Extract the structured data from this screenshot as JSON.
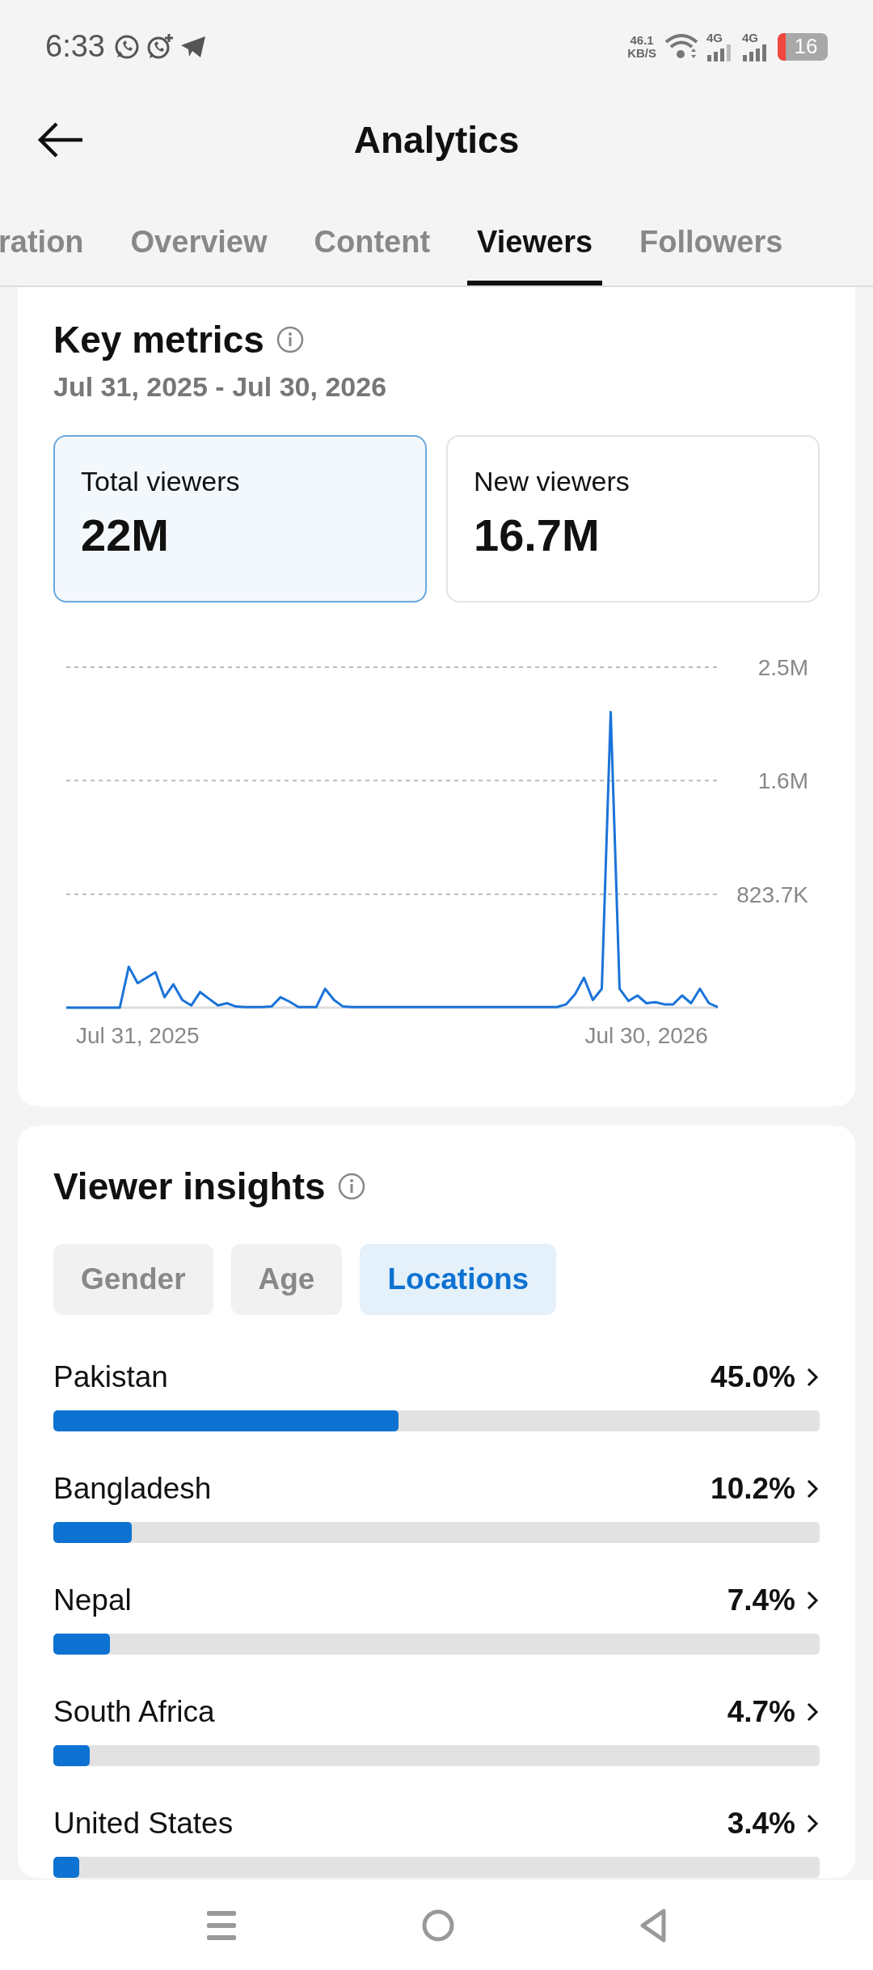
{
  "status_bar": {
    "time": "6:33",
    "net_speed": "46.1",
    "net_unit": "KB/S",
    "networks": [
      "4G",
      "4G"
    ],
    "battery": "16"
  },
  "header": {
    "title": "Analytics"
  },
  "tabs": [
    {
      "label": "ration",
      "selected": false
    },
    {
      "label": "Overview",
      "selected": false
    },
    {
      "label": "Content",
      "selected": false
    },
    {
      "label": "Viewers",
      "selected": true
    },
    {
      "label": "Followers",
      "selected": false
    }
  ],
  "key_metrics": {
    "title": "Key metrics",
    "date_range": "Jul 31, 2025 - Jul 30, 2026",
    "metrics": [
      {
        "label": "Total viewers",
        "value": "22M",
        "selected": true
      },
      {
        "label": "New viewers",
        "value": "16.7M",
        "selected": false
      }
    ],
    "chart_data": {
      "type": "line",
      "categories": [
        null,
        null,
        null,
        null,
        null,
        null,
        null,
        null,
        "Jul 31, 2025",
        null,
        null,
        null,
        null,
        null,
        null,
        null,
        null,
        null,
        null,
        null,
        null,
        null,
        null,
        null,
        null,
        null,
        null,
        null,
        null,
        null,
        null,
        null,
        null,
        null,
        null,
        null,
        null,
        null,
        null,
        null,
        null,
        null,
        null,
        null,
        null,
        null,
        null,
        null,
        null,
        null,
        null,
        null,
        null,
        null,
        null,
        null,
        null,
        null,
        null,
        null,
        null,
        null,
        null,
        null,
        null,
        "Jul 30, 2026",
        null,
        null,
        null,
        null,
        null,
        null,
        null,
        null
      ],
      "series": [
        {
          "color": "#1a73d9",
          "values": [
            0,
            0,
            0,
            0,
            0,
            0,
            0,
            297000,
            177000,
            217000,
            257000,
            76000,
            169000,
            56000,
            16000,
            113000,
            64000,
            16000,
            32000,
            8000,
            4000,
            4000,
            4000,
            8000,
            76000,
            44000,
            4000,
            4000,
            4000,
            137000,
            56000,
            8000,
            4000,
            4000,
            4000,
            4000,
            4000,
            4000,
            4000,
            4000,
            4000,
            4000,
            4000,
            4000,
            4000,
            4000,
            4000,
            4000,
            4000,
            4000,
            4000,
            4000,
            4000,
            4000,
            4000,
            4000,
            24000,
            96000,
            217000,
            56000,
            137000,
            2146000,
            137000,
            48000,
            88000,
            32000,
            40000,
            24000,
            24000,
            88000,
            32000,
            137000,
            32000,
            4000
          ]
        }
      ],
      "ylim": [
        0,
        2471100
      ],
      "yticks": [
        {
          "value": 823700,
          "label": "823.7K"
        },
        {
          "value": 1647400,
          "label": "1.6M"
        },
        {
          "value": 2471100,
          "label": "2.5M"
        }
      ]
    }
  },
  "viewer_insights": {
    "title": "Viewer insights",
    "filters": [
      {
        "label": "Gender",
        "selected": false
      },
      {
        "label": "Age",
        "selected": false
      },
      {
        "label": "Locations",
        "selected": true
      }
    ],
    "locations": [
      {
        "name": "Pakistan",
        "percent": "45.0%",
        "level": 0.45
      },
      {
        "name": "Bangladesh",
        "percent": "10.2%",
        "level": 0.102
      },
      {
        "name": "Nepal",
        "percent": "7.4%",
        "level": 0.074
      },
      {
        "name": "South Africa",
        "percent": "4.7%",
        "level": 0.047
      },
      {
        "name": "United States",
        "percent": "3.4%",
        "level": 0.034
      }
    ]
  }
}
